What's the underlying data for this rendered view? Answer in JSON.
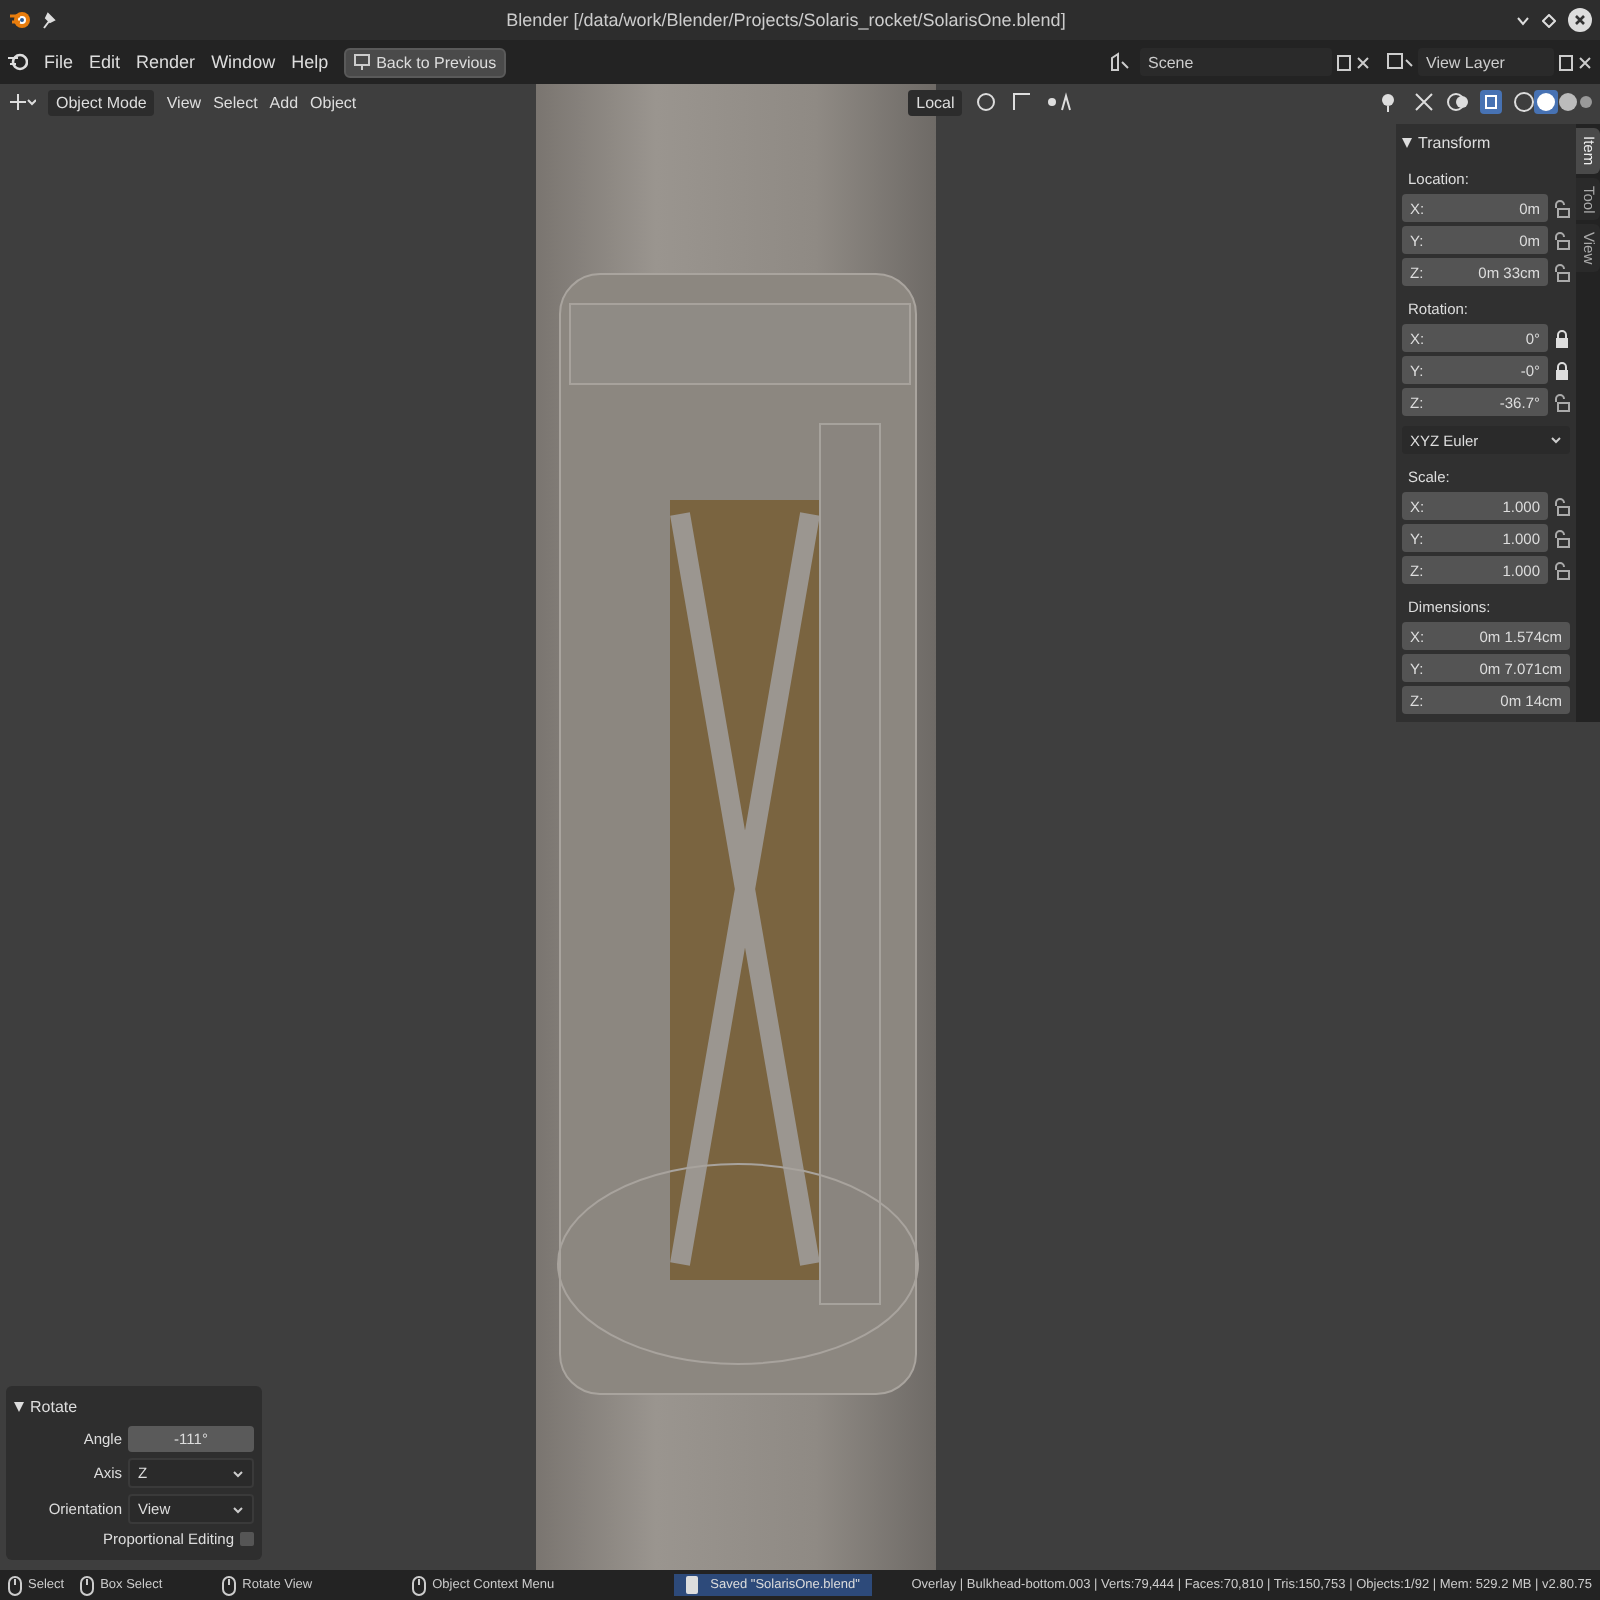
{
  "window": {
    "title": "Blender [/data/work/Blender/Projects/Solaris_rocket/SolarisOne.blend]"
  },
  "menu": [
    "File",
    "Edit",
    "Render",
    "Window",
    "Help"
  ],
  "back_button": "Back to Previous",
  "scene": "Scene",
  "view_layer": "View Layer",
  "viewport_header": {
    "mode": "Object Mode",
    "menus": [
      "View",
      "Select",
      "Add",
      "Object"
    ],
    "orientation": "Local"
  },
  "sidebar": {
    "panel": "Transform",
    "tabs": [
      {
        "label": "Item",
        "selected": true
      },
      {
        "label": "Tool",
        "selected": false
      },
      {
        "label": "View",
        "selected": false
      }
    ],
    "groups": [
      {
        "label": "Location:",
        "fields": [
          {
            "axis": "X:",
            "value": "0m",
            "locked": false
          },
          {
            "axis": "Y:",
            "value": "0m",
            "locked": false
          },
          {
            "axis": "Z:",
            "value": "0m 33cm",
            "locked": false
          }
        ]
      },
      {
        "label": "Rotation:",
        "fields": [
          {
            "axis": "X:",
            "value": "0°",
            "locked": true
          },
          {
            "axis": "Y:",
            "value": "-0°",
            "locked": true
          },
          {
            "axis": "Z:",
            "value": "-36.7°",
            "locked": false
          }
        ],
        "mode": "XYZ Euler"
      },
      {
        "label": "Scale:",
        "fields": [
          {
            "axis": "X:",
            "value": "1.000",
            "locked": false
          },
          {
            "axis": "Y:",
            "value": "1.000",
            "locked": false
          },
          {
            "axis": "Z:",
            "value": "1.000",
            "locked": false
          }
        ]
      },
      {
        "label": "Dimensions:",
        "fields": [
          {
            "axis": "X:",
            "value": "0m 1.574cm"
          },
          {
            "axis": "Y:",
            "value": "0m 7.071cm"
          },
          {
            "axis": "Z:",
            "value": "0m 14cm"
          }
        ]
      }
    ]
  },
  "operator_panel": {
    "title": "Rotate",
    "fields": [
      {
        "kind": "number",
        "label": "Angle",
        "value": "-111°"
      },
      {
        "kind": "dropdown",
        "label": "Axis",
        "value": "Z"
      },
      {
        "kind": "dropdown",
        "label": "Orientation",
        "value": "View"
      },
      {
        "kind": "checkbox",
        "label": "Proportional Editing",
        "checked": false
      }
    ]
  },
  "status_bar": {
    "hints": [
      "Select",
      "Box Select",
      "Rotate View",
      "Object Context Menu"
    ],
    "message": "Saved \"SolarisOne.blend\"",
    "stats": "Overlay | Bulkhead-bottom.003 | Verts:79,444 | Faces:70,810 | Tris:150,753 | Objects:1/92 | Mem: 529.2 MB | v2.80.75"
  }
}
